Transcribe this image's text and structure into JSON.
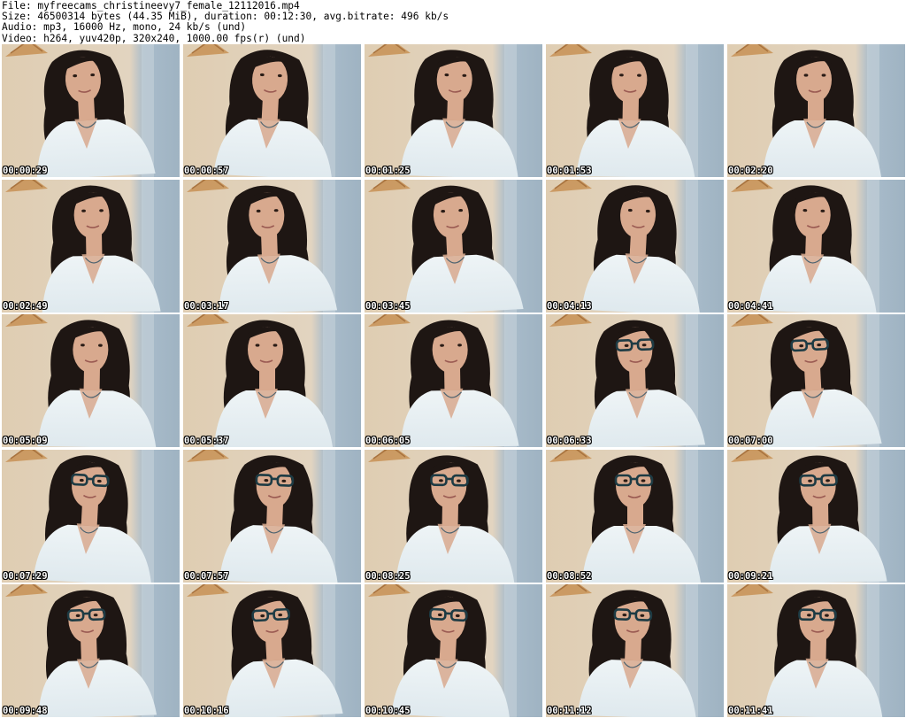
{
  "header": {
    "file_line": "File: myfreecams_christineevy7_female_12112016.mp4",
    "size_line": "Size: 46500314 bytes (44.35 MiB), duration: 00:12:30, avg.bitrate: 496 kb/s",
    "audio_line": "Audio: mp3, 16000 Hz, mono, 24 kb/s (und)",
    "video_line": "Video: h264, yuv420p, 320x240, 1000.00 fps(r) (und)"
  },
  "thumbnails": [
    {
      "timestamp": "00:00:29",
      "glasses": false
    },
    {
      "timestamp": "00:00:57",
      "glasses": false
    },
    {
      "timestamp": "00:01:25",
      "glasses": false
    },
    {
      "timestamp": "00:01:53",
      "glasses": false
    },
    {
      "timestamp": "00:02:20",
      "glasses": false
    },
    {
      "timestamp": "00:02:49",
      "glasses": false
    },
    {
      "timestamp": "00:03:17",
      "glasses": false
    },
    {
      "timestamp": "00:03:45",
      "glasses": false
    },
    {
      "timestamp": "00:04:13",
      "glasses": false
    },
    {
      "timestamp": "00:04:41",
      "glasses": false
    },
    {
      "timestamp": "00:05:09",
      "glasses": false
    },
    {
      "timestamp": "00:05:37",
      "glasses": false
    },
    {
      "timestamp": "00:06:05",
      "glasses": false
    },
    {
      "timestamp": "00:06:33",
      "glasses": true
    },
    {
      "timestamp": "00:07:00",
      "glasses": true
    },
    {
      "timestamp": "00:07:29",
      "glasses": true
    },
    {
      "timestamp": "00:07:57",
      "glasses": true
    },
    {
      "timestamp": "00:08:25",
      "glasses": true
    },
    {
      "timestamp": "00:08:52",
      "glasses": true
    },
    {
      "timestamp": "00:09:21",
      "glasses": true
    },
    {
      "timestamp": "00:09:48",
      "glasses": true
    },
    {
      "timestamp": "00:10:16",
      "glasses": true
    },
    {
      "timestamp": "00:10:45",
      "glasses": true
    },
    {
      "timestamp": "00:11:12",
      "glasses": true
    },
    {
      "timestamp": "00:11:41",
      "glasses": true
    }
  ],
  "colors": {
    "wall_left": "#dfcdb2",
    "wall_right": "#a9bccb",
    "fan": "#c9955a",
    "hair": "#1e1613",
    "skin": "#d8a98e",
    "blouse": "#dfe9ee",
    "glasses": "#1d3b44"
  }
}
